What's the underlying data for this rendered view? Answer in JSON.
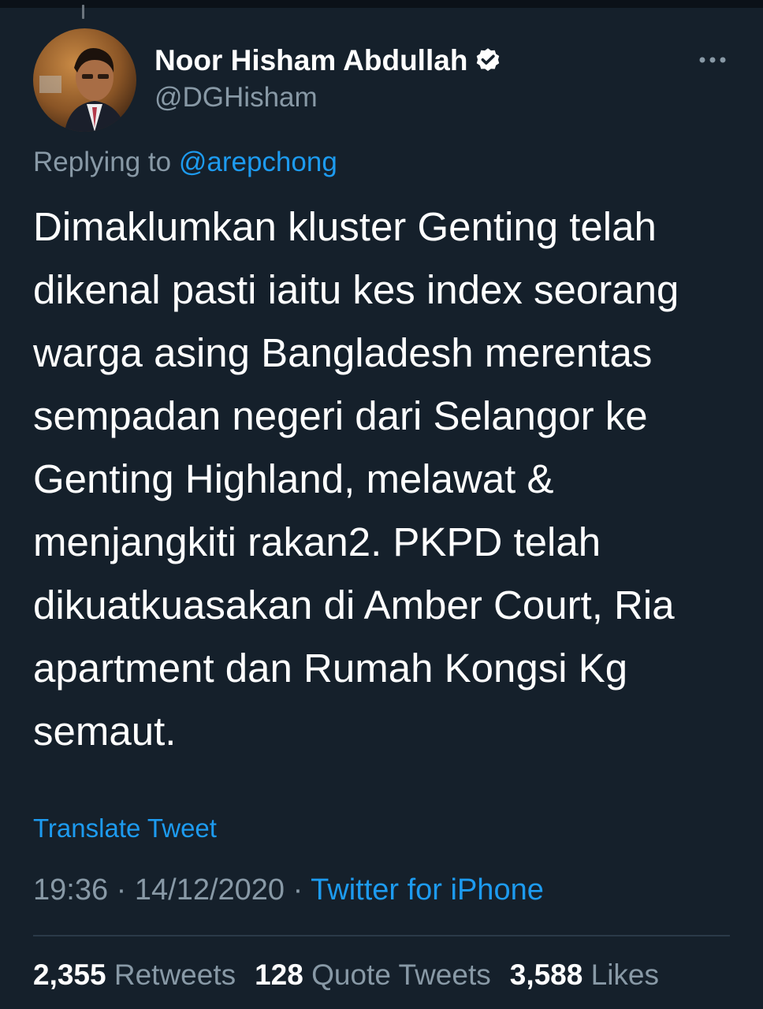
{
  "author": {
    "display_name": "Noor Hisham Abdullah",
    "handle": "@DGHisham",
    "verified": true
  },
  "reply": {
    "prefix": "Replying to",
    "to_handle": "@arepchong"
  },
  "tweet": {
    "text": "Dimaklumkan kluster Genting telah\ndikenal pasti iaitu kes index seorang\nwarga asing Bangladesh merentas\nsempadan negeri dari Selangor ke\nGenting Highland, melawat &\nmenjangkiti rakan2. PKPD telah\ndikuatkuasakan di Amber Court, Ria\napartment dan Rumah Kongsi Kg\nsemaut.",
    "translate_label": "Translate Tweet",
    "time": "19:36",
    "date": "14/12/2020",
    "separator": "·",
    "source": "Twitter for iPhone"
  },
  "stats": {
    "retweets": {
      "count": "2,355",
      "label": "Retweets"
    },
    "quotes": {
      "count": "128",
      "label": "Quote Tweets"
    },
    "likes": {
      "count": "3,588",
      "label": "Likes"
    }
  },
  "icons": {
    "verified": "verified-badge-icon",
    "more": "more-options-icon"
  },
  "colors": {
    "background": "#15202b",
    "link": "#1d9bf0",
    "secondary_text": "#8899a6"
  }
}
